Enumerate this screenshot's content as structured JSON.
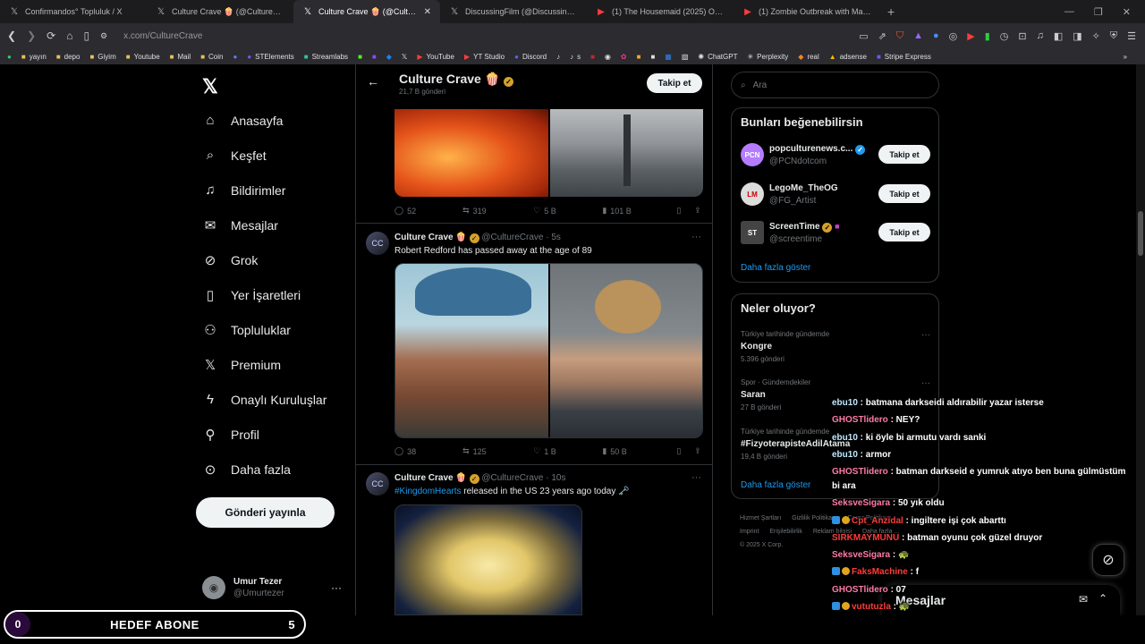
{
  "browser": {
    "tabs": [
      {
        "icon": "x-logo-icon",
        "title": "Confirmandos° Topluluk / X",
        "active": false
      },
      {
        "icon": "x-logo-icon",
        "title": "Culture Crave 🍿 (@CultureCrave) / X",
        "active": false
      },
      {
        "icon": "x-logo-icon",
        "title": "Culture Crave 🍿 (@CultureCrave) / X",
        "active": true
      },
      {
        "icon": "x-logo-icon",
        "title": "DiscussingFilm (@DiscussingFilm) / X",
        "active": false
      },
      {
        "icon": "youtube-icon",
        "title": "(1) The Housemaid (2025) Official Trailer",
        "active": false
      },
      {
        "icon": "youtube-icon",
        "title": "(1) Zombie Outbreak with Marvel Heroes",
        "active": false
      }
    ],
    "url_host": "x.com/",
    "url_path": "CultureCrave",
    "bookmarks": [
      "yayın",
      "depo",
      "Giyim",
      "Youtube",
      "Mail",
      "Coin",
      "STElements",
      "Streamlabs",
      "YouTube",
      "YT Studio",
      "Discord",
      "s",
      "ChatGPT",
      "Perplexity",
      "real",
      "adsense",
      "Stripe Express"
    ]
  },
  "nav": {
    "items": [
      "Anasayfa",
      "Keşfet",
      "Bildirimler",
      "Mesajlar",
      "Grok",
      "Yer İşaretleri",
      "Topluluklar",
      "Premium",
      "Onaylı Kuruluşlar",
      "Profil",
      "Daha fazla"
    ],
    "post_button": "Gönderi yayınla",
    "user_name": "Umur Tezer",
    "user_handle": "@Umurtezer"
  },
  "header": {
    "title": "Culture Crave 🍿",
    "subtitle": "21,7 B gönderi",
    "follow": "Takip et"
  },
  "posts": [
    {
      "stats": {
        "replies": "52",
        "reposts": "319",
        "likes": "5 B",
        "views": "101 B"
      }
    },
    {
      "author": "Culture Crave 🍿",
      "handle": "@CultureCrave",
      "time": "· 5s",
      "text": "Robert Redford has passed away at the age of 89",
      "stats": {
        "replies": "38",
        "reposts": "125",
        "likes": "1 B",
        "views": "50 B"
      }
    },
    {
      "author": "Culture Crave 🍿",
      "handle": "@CultureCrave",
      "time": "· 10s",
      "hashtag": "#KingdomHearts",
      "text": " released in the US 23 years ago today 🗝️"
    }
  ],
  "search": {
    "placeholder": "Ara"
  },
  "suggestions": {
    "title": "Bunları beğenebilirsin",
    "items": [
      {
        "name": "popculturenews.c...",
        "handle": "@PCNdotcom",
        "button": "Takip et",
        "avatar_text": "PCN"
      },
      {
        "name": "LegoMe_TheOG",
        "handle": "@FG_Artist",
        "button": "Takip et",
        "avatar_text": "LM"
      },
      {
        "name": "ScreenTime",
        "handle": "@screentime",
        "button": "Takip et",
        "avatar_text": "ST"
      }
    ],
    "show_more": "Daha fazla göster"
  },
  "trends": {
    "title": "Neler oluyor?",
    "items": [
      {
        "category": "Türkiye tarihinde gündemde",
        "name": "Kongre",
        "count": "5.396 gönderi"
      },
      {
        "category": "Spor · Gündemdekiler",
        "name": "Saran",
        "count": "27 B gönderi"
      },
      {
        "category": "Türkiye tarihinde gündemde",
        "name": "#FizyoterapisteAdilAtama",
        "count": "19,4 B gönderi"
      }
    ],
    "show_more": "Daha fazla göster"
  },
  "footer": [
    "Hizmet Şartları",
    "Gizlilik Politikası",
    "Çerez Politikası",
    "Imprint",
    "Erişilebilirlik",
    "Reklam bilgisi",
    "Daha fazla ...",
    "© 2025 X Corp."
  ],
  "messages_drawer": {
    "title": "Mesajlar"
  },
  "chat": [
    {
      "user": "ebu10",
      "msg": " : batmana darkseidi aldırabilir yazar isterse",
      "color": "u1"
    },
    {
      "user": "GHOSTlidero",
      "msg": " : NEY?",
      "color": "u2"
    },
    {
      "user": "ebu10",
      "msg": " : ki öyle bi armutu vardı sanki",
      "color": "u1"
    },
    {
      "user": "ebu10",
      "msg": " : armor",
      "color": "u1"
    },
    {
      "user": "GHOSTlidero",
      "msg": " : batman darkseid e yumruk atıyo ben buna gülmüstüm",
      "color": "u2"
    },
    {
      "user": "",
      "msg": "bi ara",
      "color": "u2"
    },
    {
      "user": "SeksveSigara",
      "msg": " : 50 yık oldu",
      "color": "u2"
    },
    {
      "user": "Cpt_Anzidal",
      "msg": " : ingiltere işi çok abarttı",
      "color": "u4"
    },
    {
      "user": "SIRKMAYMUNU",
      "msg": " : batman oyunu çok güzel druyor",
      "color": "u4"
    },
    {
      "user": "SeksveSigara",
      "msg": " : 🐢",
      "color": "u2"
    },
    {
      "user": "FaksMachine",
      "msg": " : f",
      "color": "u4"
    },
    {
      "user": "GHOSTlidero",
      "msg": " : 07",
      "color": "u2"
    },
    {
      "user": "vututuzla",
      "msg": " : 🐢",
      "color": "u4"
    }
  ],
  "goal": {
    "start": "0",
    "label": "HEDEF ABONE",
    "end": "5"
  }
}
